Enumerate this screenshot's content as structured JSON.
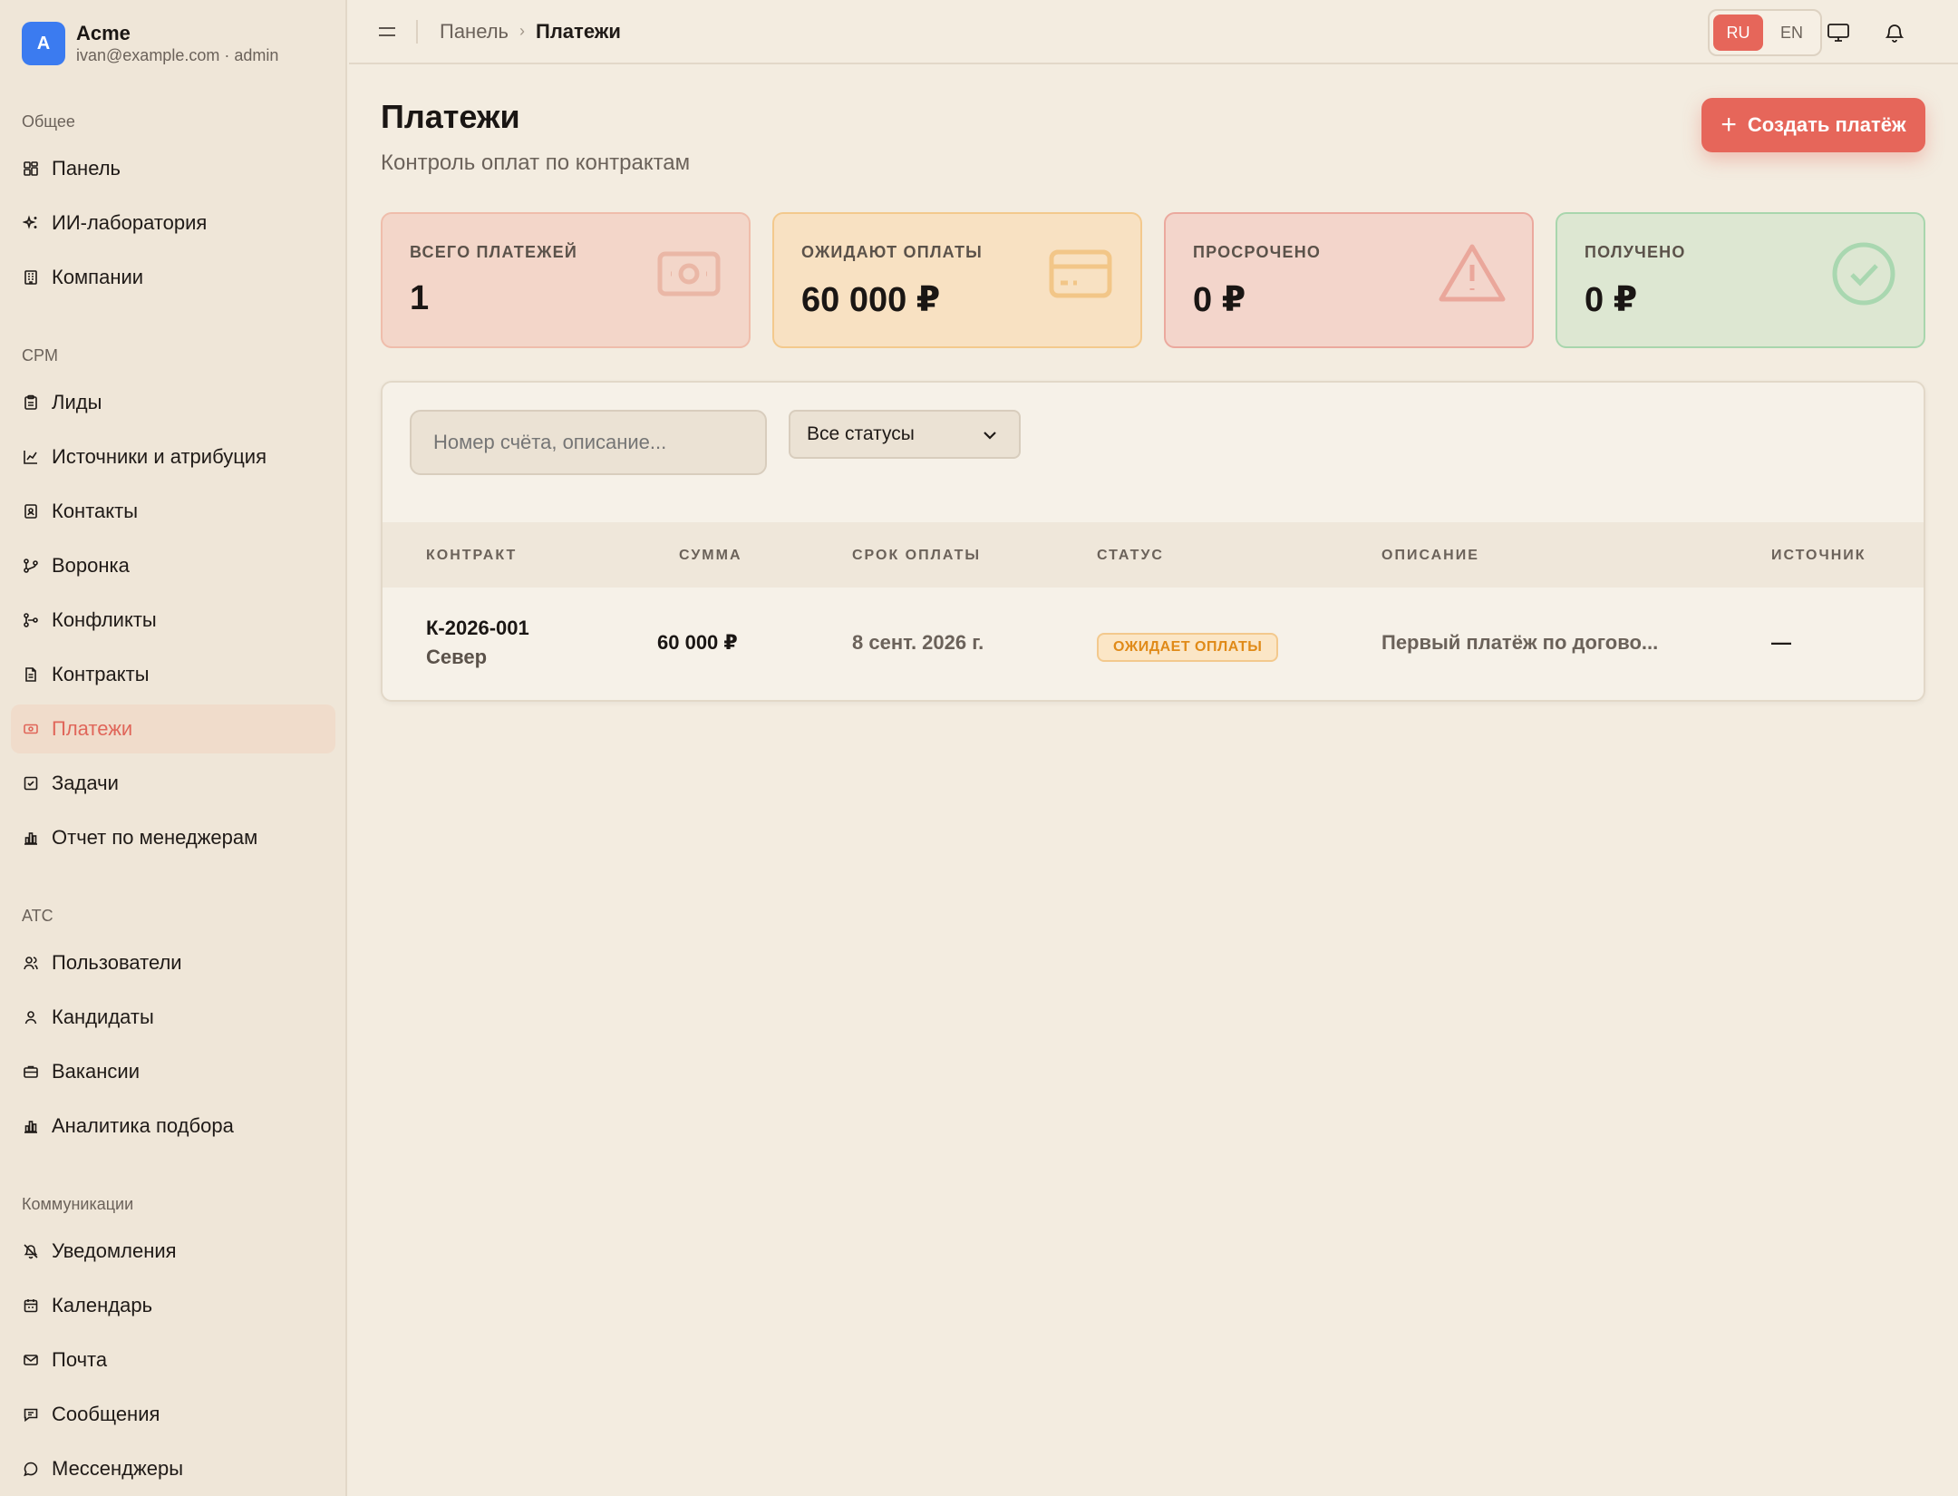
{
  "brand": {
    "initial": "A",
    "name": "Acme",
    "sub": "ivan@example.com · admin"
  },
  "sidebar": {
    "sections": [
      {
        "title": "Общее"
      },
      {
        "title": "CPM"
      },
      {
        "title": "ATC"
      },
      {
        "title": "Коммуникации"
      }
    ],
    "items": [
      {
        "label": "Панель",
        "icon": "dashboard-icon"
      },
      {
        "label": "ИИ-лаборатория",
        "icon": "sparkles-icon"
      },
      {
        "label": "Компании",
        "icon": "building-icon"
      },
      {
        "label": "Лиды",
        "icon": "clipboard-icon"
      },
      {
        "label": "Источники и атрибуция",
        "icon": "chart-line-icon"
      },
      {
        "label": "Контакты",
        "icon": "contact-icon"
      },
      {
        "label": "Воронка",
        "icon": "funnel-icon"
      },
      {
        "label": "Конфликты",
        "icon": "git-branch-icon"
      },
      {
        "label": "Контракты",
        "icon": "document-icon"
      },
      {
        "label": "Платежи",
        "icon": "banknote-icon",
        "active": true
      },
      {
        "label": "Задачи",
        "icon": "checkbox-icon"
      },
      {
        "label": "Отчет по менеджерам",
        "icon": "bar-chart-icon"
      },
      {
        "label": "Пользователи",
        "icon": "users-icon"
      },
      {
        "label": "Кандидаты",
        "icon": "user-icon"
      },
      {
        "label": "Вакансии",
        "icon": "briefcase-icon"
      },
      {
        "label": "Аналитика подбора",
        "icon": "bar-chart-icon"
      },
      {
        "label": "Уведомления",
        "icon": "bell-off-icon"
      },
      {
        "label": "Календарь",
        "icon": "calendar-icon"
      },
      {
        "label": "Почта",
        "icon": "mail-icon"
      },
      {
        "label": "Сообщения",
        "icon": "message-square-icon"
      },
      {
        "label": "Мессенджеры",
        "icon": "message-circle-icon"
      }
    ]
  },
  "topbar": {
    "breadcrumb": [
      "Панель",
      "Платежи"
    ],
    "lang": {
      "ru": "RU",
      "en": "EN",
      "active": "RU"
    }
  },
  "page": {
    "title": "Платежи",
    "subtitle": "Контроль оплат по контрактам",
    "create_label": "Создать платёж"
  },
  "stats": [
    {
      "label": "ВСЕГО ПЛАТЕЖЕЙ",
      "value": "1",
      "icon": "banknote-icon"
    },
    {
      "label": "ОЖИДАЮТ ОПЛАТЫ",
      "value": "60 000 ₽",
      "icon": "credit-card-icon"
    },
    {
      "label": "ПРОСРОЧЕНО",
      "value": "0 ₽",
      "icon": "warning-icon"
    },
    {
      "label": "ПОЛУЧЕНО",
      "value": "0 ₽",
      "icon": "check-circle-icon"
    }
  ],
  "filters": {
    "search_placeholder": "Номер счёта, описание...",
    "status_selected": "Все статусы"
  },
  "table": {
    "headers": [
      "КОНТРАКТ",
      "СУММА",
      "СРОК ОПЛАТЫ",
      "СТАТУС",
      "ОПИСАНИЕ",
      "ИСТОЧНИК"
    ],
    "rows": [
      {
        "contract": "К-2026-001",
        "company": "Север",
        "amount": "60 000 ₽",
        "due": "8 сент. 2026 г.",
        "status": "ОЖИДАЕТ ОПЛАТЫ",
        "description": "Первый платёж по догово...",
        "source": "—"
      }
    ]
  },
  "colors": {
    "accent": "#e6665a",
    "pending": "#e08a18",
    "brand_avatar": "#3b7bf0"
  }
}
